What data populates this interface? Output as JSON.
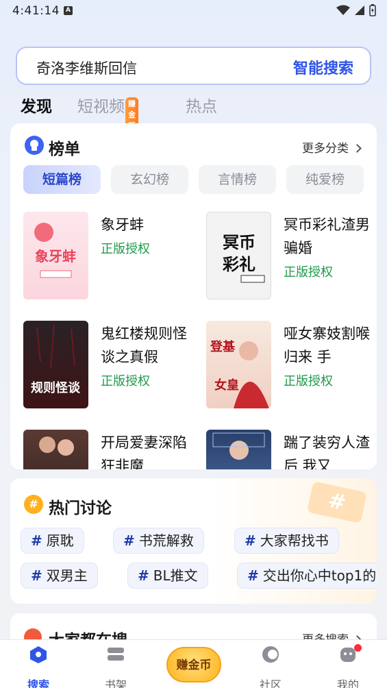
{
  "status_bar": {
    "time": "4:41:14",
    "a_badge": "A"
  },
  "search": {
    "query": "奇洛李维斯回信",
    "button": "智能搜索"
  },
  "top_tabs": [
    {
      "label": "发现",
      "active": true
    },
    {
      "label": "短视频",
      "badge": "赚金币"
    },
    {
      "label": "热点"
    }
  ],
  "ranking": {
    "title": "榜单",
    "more": "更多分类",
    "chips": [
      "短篇榜",
      "玄幻榜",
      "言情榜",
      "纯爱榜"
    ],
    "books": [
      {
        "title": "象牙蚌",
        "tag": "正版授权",
        "cover_text": "象牙蚌"
      },
      {
        "title": "冥币彩礼渣男骗婚",
        "tag": "正版授权",
        "cover_text": "冥币彩礼"
      },
      {
        "title": "鬼红楼规则怪谈之真假",
        "tag": "正版授权",
        "cover_text": "规则怪谈"
      },
      {
        "title": "哑女寨妓割喉归来 手",
        "tag": "正版授权",
        "cover_text": "登基女皇"
      },
      {
        "title": "开局爱妻深陷狂非魔",
        "tag": "",
        "cover_text": ""
      },
      {
        "title": "踹了装穷人渣后 我又",
        "tag": "",
        "cover_text": ""
      }
    ]
  },
  "hot": {
    "title": "热门讨论",
    "topics": [
      "原耽",
      "书荒解救",
      "大家帮找书",
      "双男主",
      "BL推文",
      "交出你心中top1的"
    ]
  },
  "everyone": {
    "title": "大家都在搜",
    "more": "更多搜索"
  },
  "nav": {
    "items": [
      "搜索",
      "书架",
      "社区",
      "我的"
    ],
    "coin": "赚金币"
  },
  "colors": {
    "accent": "#2f55e8",
    "green": "#1e9a4a"
  }
}
